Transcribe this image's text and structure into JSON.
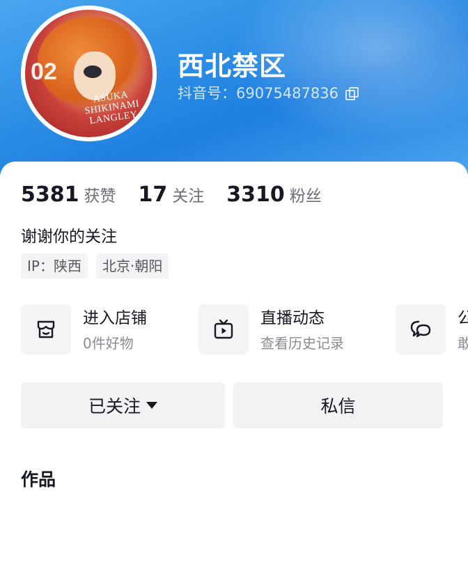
{
  "profile": {
    "name": "西北禁区",
    "id_label": "抖音号：69075487836",
    "avatar": {
      "number": "02",
      "signature": "ASUKA SHIKINAMI LANGLEY"
    }
  },
  "stats": [
    {
      "value": "5381",
      "label": "获赞"
    },
    {
      "value": "17",
      "label": "关注"
    },
    {
      "value": "3310",
      "label": "粉丝"
    }
  ],
  "bio": "谢谢你的关注",
  "tags": [
    "IP：陕西",
    "北京·朝阳"
  ],
  "features": [
    {
      "icon": "shop-icon",
      "title": "进入店铺",
      "subtitle": "0件好物"
    },
    {
      "icon": "live-tv-icon",
      "title": "直播动态",
      "subtitle": "查看历史记录"
    },
    {
      "icon": "chat-bubbles-icon",
      "title": "公",
      "subtitle": "敢"
    }
  ],
  "buttons": {
    "followed": "已关注",
    "message": "私信"
  },
  "section_title": "作品",
  "colors": {
    "banner": "#2e8fe6",
    "text": "#161823",
    "muted": "#8a8c94"
  }
}
